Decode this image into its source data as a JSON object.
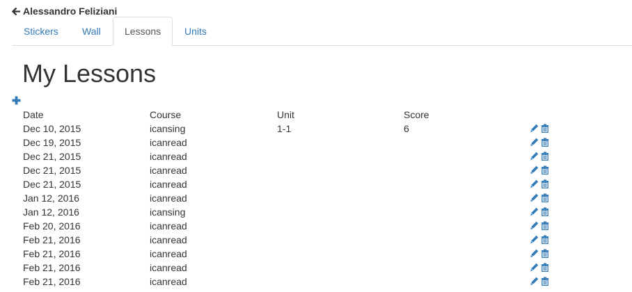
{
  "header": {
    "student_name": "Alessandro Feliziani",
    "back_icon": "arrow-left-icon"
  },
  "tabs": [
    {
      "label": "Stickers",
      "active": false
    },
    {
      "label": "Wall",
      "active": false
    },
    {
      "label": "Lessons",
      "active": true
    },
    {
      "label": "Units",
      "active": false
    }
  ],
  "main": {
    "title": "My Lessons",
    "add_icon": "plus-icon",
    "columns": {
      "date": "Date",
      "course": "Course",
      "unit": "Unit",
      "score": "Score"
    },
    "rows": [
      {
        "date": "Dec 10, 2015",
        "course": "icansing",
        "unit": "1-1",
        "score": "6"
      },
      {
        "date": "Dec 19, 2015",
        "course": "icanread",
        "unit": "",
        "score": ""
      },
      {
        "date": "Dec 21, 2015",
        "course": "icanread",
        "unit": "",
        "score": ""
      },
      {
        "date": "Dec 21, 2015",
        "course": "icanread",
        "unit": "",
        "score": ""
      },
      {
        "date": "Dec 21, 2015",
        "course": "icanread",
        "unit": "",
        "score": ""
      },
      {
        "date": "Jan 12, 2016",
        "course": "icanread",
        "unit": "",
        "score": ""
      },
      {
        "date": "Jan 12, 2016",
        "course": "icansing",
        "unit": "",
        "score": ""
      },
      {
        "date": "Feb 20, 2016",
        "course": "icanread",
        "unit": "",
        "score": ""
      },
      {
        "date": "Feb 21, 2016",
        "course": "icanread",
        "unit": "",
        "score": ""
      },
      {
        "date": "Feb 21, 2016",
        "course": "icanread",
        "unit": "",
        "score": ""
      },
      {
        "date": "Feb 21, 2016",
        "course": "icanread",
        "unit": "",
        "score": ""
      },
      {
        "date": "Feb 21, 2016",
        "course": "icanread",
        "unit": "",
        "score": ""
      }
    ],
    "row_icons": {
      "edit": "pencil-icon",
      "delete": "trash-icon"
    }
  },
  "colors": {
    "link": "#337ab7",
    "text": "#333333",
    "border": "#dddddd"
  }
}
